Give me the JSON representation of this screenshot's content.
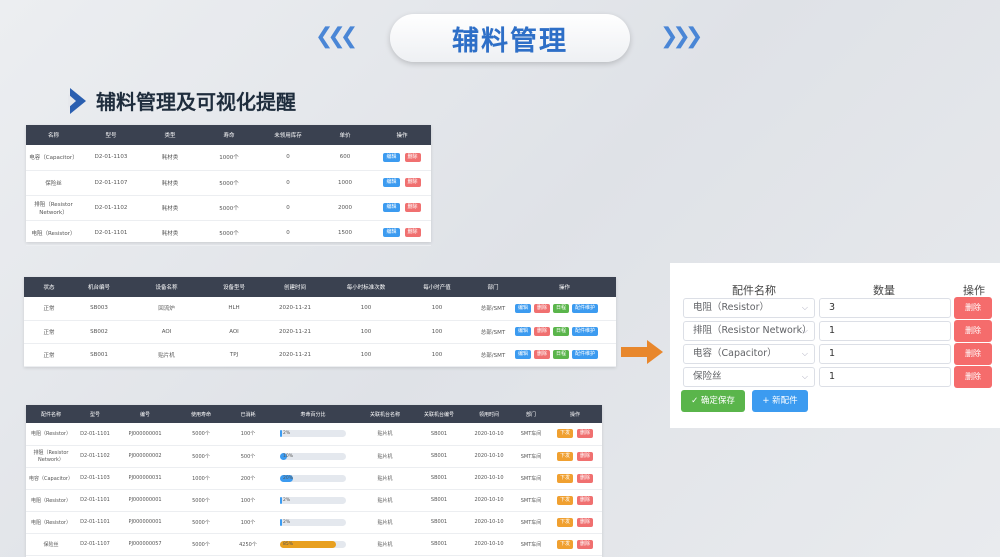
{
  "header": {
    "title": "辅料管理"
  },
  "section": {
    "title": "辅料管理及可视化提醒"
  },
  "table1": {
    "headers": [
      "名称",
      "型号",
      "类型",
      "寿命",
      "未领用库存",
      "单价",
      "操作"
    ],
    "rows": [
      [
        "电容（Capacitor）",
        "D2-01-1103",
        "耗材类",
        "1000个",
        "0",
        "600"
      ],
      [
        "保险丝",
        "D2-01-1107",
        "耗材类",
        "5000个",
        "0",
        "1000"
      ],
      [
        "排阻（Resistor Network）",
        "D2-01-1102",
        "耗材类",
        "5000个",
        "0",
        "2000"
      ],
      [
        "电阻（Resistor）",
        "D2-01-1101",
        "耗材类",
        "5000个",
        "0",
        "1500"
      ]
    ],
    "edit": "编辑",
    "delete": "删除"
  },
  "table2": {
    "headers": [
      "状态",
      "机台编号",
      "设备名称",
      "设备型号",
      "创建时间",
      "每小时标准次数",
      "每小时产值",
      "部门",
      "操作"
    ],
    "rows": [
      [
        "正常",
        "SB003",
        "回流炉",
        "HLH",
        "2020-11-21",
        "100",
        "100",
        "总部/SMT"
      ],
      [
        "正常",
        "SB002",
        "AOI",
        "AOI",
        "2020-11-21",
        "100",
        "100",
        "总部/SMT"
      ],
      [
        "正常",
        "SB001",
        "贴片机",
        "TPJ",
        "2020-11-21",
        "100",
        "100",
        "总部/SMT"
      ]
    ],
    "actions": [
      "编辑",
      "删除",
      "日程",
      "配件维护"
    ]
  },
  "table3": {
    "headers": [
      "配件名称",
      "型号",
      "编号",
      "使用寿命",
      "已消耗",
      "寿命百分比",
      "关联机台名称",
      "关联机台编号",
      "领用时间",
      "部门",
      "操作"
    ],
    "rows": [
      {
        "name": "电阻（Resistor）",
        "model": "D2-01-1101",
        "code": "PJ000000001",
        "life": "5000个",
        "used": "100个",
        "pct": 2,
        "pct_label": "2%",
        "machine": "贴片机",
        "machine_no": "SB001",
        "date": "2020-10-10",
        "dept": "SMT车间"
      },
      {
        "name": "排阻（Resistor Network）",
        "model": "D2-01-1102",
        "code": "PJ000000002",
        "life": "5000个",
        "used": "500个",
        "pct": 10,
        "pct_label": "10%",
        "machine": "贴片机",
        "machine_no": "SB001",
        "date": "2020-10-10",
        "dept": "SMT车间"
      },
      {
        "name": "电容（Capacitor）",
        "model": "D2-01-1103",
        "code": "PJ000000031",
        "life": "1000个",
        "used": "200个",
        "pct": 20,
        "pct_label": "20%",
        "machine": "贴片机",
        "machine_no": "SB001",
        "date": "2020-10-10",
        "dept": "SMT车间"
      },
      {
        "name": "电阻（Resistor）",
        "model": "D2-01-1101",
        "code": "PJ000000001",
        "life": "5000个",
        "used": "100个",
        "pct": 2,
        "pct_label": "2%",
        "machine": "贴片机",
        "machine_no": "SB001",
        "date": "2020-10-10",
        "dept": "SMT车间"
      },
      {
        "name": "电阻（Resistor）",
        "model": "D2-01-1101",
        "code": "PJ000000001",
        "life": "5000个",
        "used": "100个",
        "pct": 2,
        "pct_label": "2%",
        "machine": "贴片机",
        "machine_no": "SB001",
        "date": "2020-10-10",
        "dept": "SMT车间"
      },
      {
        "name": "保险丝",
        "model": "D2-01-1107",
        "code": "PJ000000057",
        "life": "5000个",
        "used": "4250个",
        "pct": 85,
        "pct_label": "85%",
        "machine": "贴片机",
        "machine_no": "SB001",
        "date": "2020-10-10",
        "dept": "SMT车间"
      }
    ],
    "actions": [
      "下发",
      "删除"
    ]
  },
  "form": {
    "headers": {
      "name": "配件名称",
      "qty": "数量",
      "op": "操作"
    },
    "rows": [
      {
        "part": "电阻（Resistor）",
        "qty": "3"
      },
      {
        "part": "排阻（Resistor Network）",
        "qty": "1"
      },
      {
        "part": "电容（Capacitor）",
        "qty": "1"
      },
      {
        "part": "保险丝",
        "qty": "1"
      }
    ],
    "delete_label": "删除",
    "save_label": "✓ 确定保存",
    "add_label": "+ 新配件"
  },
  "colors": {
    "accent": "#2e6fc7",
    "header_bg": "#3a4150",
    "blue": "#3c9bf0",
    "red": "#f07070",
    "green": "#5ab54b",
    "orange": "#f0a030",
    "warn_bar": "#e8a020"
  },
  "icons": [
    "chevrons-left-icon",
    "chevrons-right-icon",
    "section-arrow-icon",
    "chevron-down-icon",
    "check-icon",
    "plus-icon",
    "right-arrow-icon"
  ]
}
